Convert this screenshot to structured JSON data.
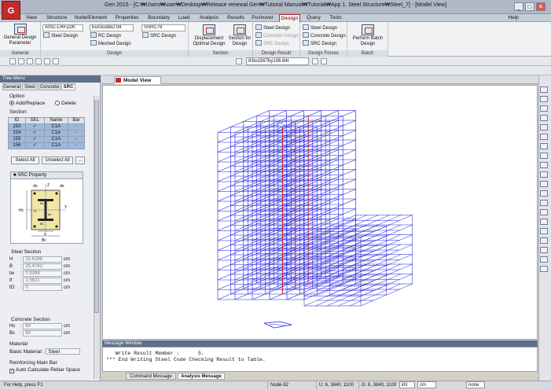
{
  "window": {
    "title": "Gen 2015 - [C:₩Users₩user₩Desktop₩Release renewal Gen₩Tutorial Manual₩Tutorial₩App 1. Steel Structure₩Steel_7] - [Model View]",
    "logo": "G",
    "min": "_",
    "max": "□",
    "close": "✕"
  },
  "menu": [
    "View",
    "Structure",
    "Node/Element",
    "Properties",
    "Boundary",
    "Load",
    "Analysis",
    "Results",
    "Pushover",
    "Design",
    "Query",
    "Tools"
  ],
  "menu_active": "Design",
  "help": "Help",
  "ribbon": {
    "general": {
      "button": "General Design Parameter",
      "label": "General"
    },
    "design": {
      "code1": "AISC-LRFD2K",
      "code2": "Eurocode2:04",
      "code3": "SSRC79",
      "steel": "Steel Design",
      "rc": "RC Design",
      "meshed": "Meshed Design",
      "src": "SRC Design",
      "label": "Design"
    },
    "section": {
      "displacement": "Displacement Optimal Design",
      "section_for": "Section for Design",
      "label": "Section"
    },
    "result": {
      "steel": "Steel Design",
      "concrete": "Concrete Design",
      "src": "SRC Design",
      "label": "Design Result"
    },
    "forces": {
      "steel": "Steel Design",
      "concrete": "Concrete Design",
      "src": "SRC Design",
      "label": "Design Forces"
    },
    "batch": {
      "perform": "Perform Batch Design",
      "label": "Batch"
    }
  },
  "coord_input": "83to1567by106 84t",
  "tree": {
    "header": "Tree Menu",
    "tabs": [
      "General",
      "Steel",
      "Concrete",
      "SRC"
    ],
    "active_tab": "SRC",
    "option": "Option",
    "add": "Add/Replace",
    "delete": "Delete",
    "section": "Section",
    "cols": [
      "ID",
      "SEL",
      "Name",
      "Bar"
    ],
    "rows": [
      {
        "id": "153",
        "sel": "✓",
        "name": "C1A",
        "bar": "-"
      },
      {
        "id": "154",
        "sel": "✓",
        "name": "C1A",
        "bar": "-"
      },
      {
        "id": "155",
        "sel": "✓",
        "name": "C1A",
        "bar": "-"
      },
      {
        "id": "156",
        "sel": "✓",
        "name": "C1A",
        "bar": "-"
      }
    ],
    "select_all": "Select All",
    "unselect_all": "Unselect All",
    "more": "...",
    "src_property": "SRC Property",
    "steel_section": "Steel Section",
    "steel_props": [
      {
        "k": "H",
        "v": "25.6286",
        "u": "cm"
      },
      {
        "k": "B",
        "v": "25.4762",
        "u": "cm"
      },
      {
        "k": "tw",
        "v": "0.9398",
        "u": "cm"
      },
      {
        "k": "tf",
        "v": "1.5621",
        "u": "cm"
      },
      {
        "k": "tf2",
        "v": "0",
        "u": "cm"
      }
    ],
    "concrete_section": "Concrete Section",
    "conc_props": [
      {
        "k": "Hc",
        "v": "60",
        "u": "cm"
      },
      {
        "k": "Bc",
        "v": "60",
        "u": "cm"
      }
    ],
    "material": "Material",
    "basic_material_label": "Basic Material :",
    "basic_material": "Steel",
    "reinforcing": "Reinforcing Main Bar",
    "auto_calc": "Auto Calculate Rebar Space",
    "fig": {
      "do": "do",
      "z": "Z",
      "y": "Y",
      "hc": "Hc",
      "bc": "Bc",
      "b": "B",
      "h": "H",
      "tf1": "tf1",
      "tf2": "tf2",
      "tw": "tw"
    }
  },
  "view_tab": "Model View",
  "message": {
    "header": "Message Window",
    "line1": "   Write Result Member :      5.",
    "line2": "*** End Writing Steel Code Checking Result to Table.",
    "tabs": [
      "Command Message",
      "Analysis Message"
    ],
    "active_tab": "Analysis Message"
  },
  "status": {
    "help": "For Help, press F1",
    "node": "Node-92",
    "u": "U: 6, 3840, 1100",
    "g": "G: 6, 3840, 1100",
    "unit1": "kN",
    "unit2": "cm",
    "none": "none"
  }
}
